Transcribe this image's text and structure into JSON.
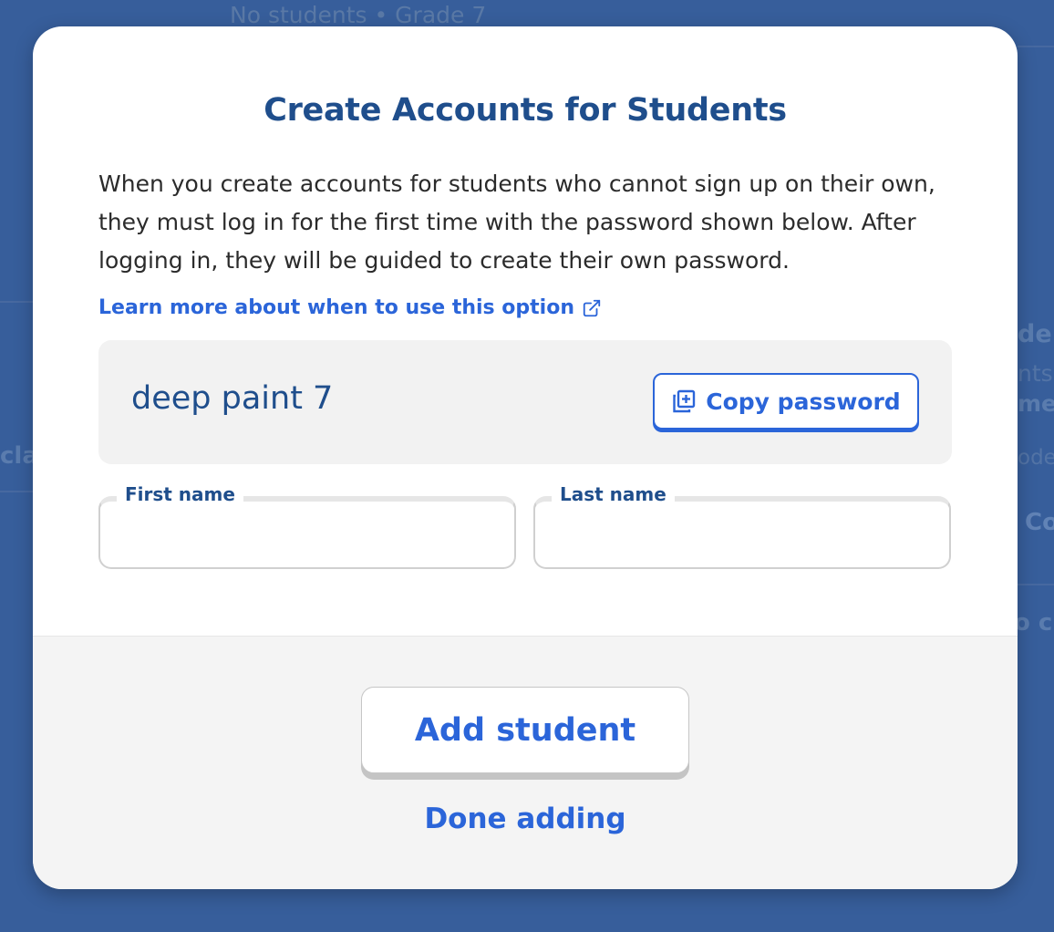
{
  "background": {
    "top_text": "No students • Grade 7",
    "right_fragments": [
      "de",
      "nts",
      "me",
      "ode",
      "Co",
      "o cr"
    ],
    "left_fragment": "clas"
  },
  "modal": {
    "title": "Create Accounts for Students",
    "description": "When you create accounts for students who cannot sign up on their own, they must log in for the first time with the password shown below. After logging in, they will be guided to create their own password.",
    "learn_more_link": "Learn more about when to use this option",
    "learn_more_icon": "external-link-icon",
    "password": {
      "value": "deep paint 7",
      "copy_button_label": "Copy password",
      "copy_icon": "copy-icon"
    },
    "fields": {
      "first_name": {
        "label": "First name",
        "value": ""
      },
      "last_name": {
        "label": "Last name",
        "value": ""
      }
    },
    "footer": {
      "add_button_label": "Add student",
      "done_link_label": "Done adding"
    }
  },
  "colors": {
    "backdrop": "#375e9b",
    "title": "#1f4e8c",
    "accent": "#2b65d9",
    "password_box": "#f2f2f2",
    "footer": "#f4f4f4"
  }
}
